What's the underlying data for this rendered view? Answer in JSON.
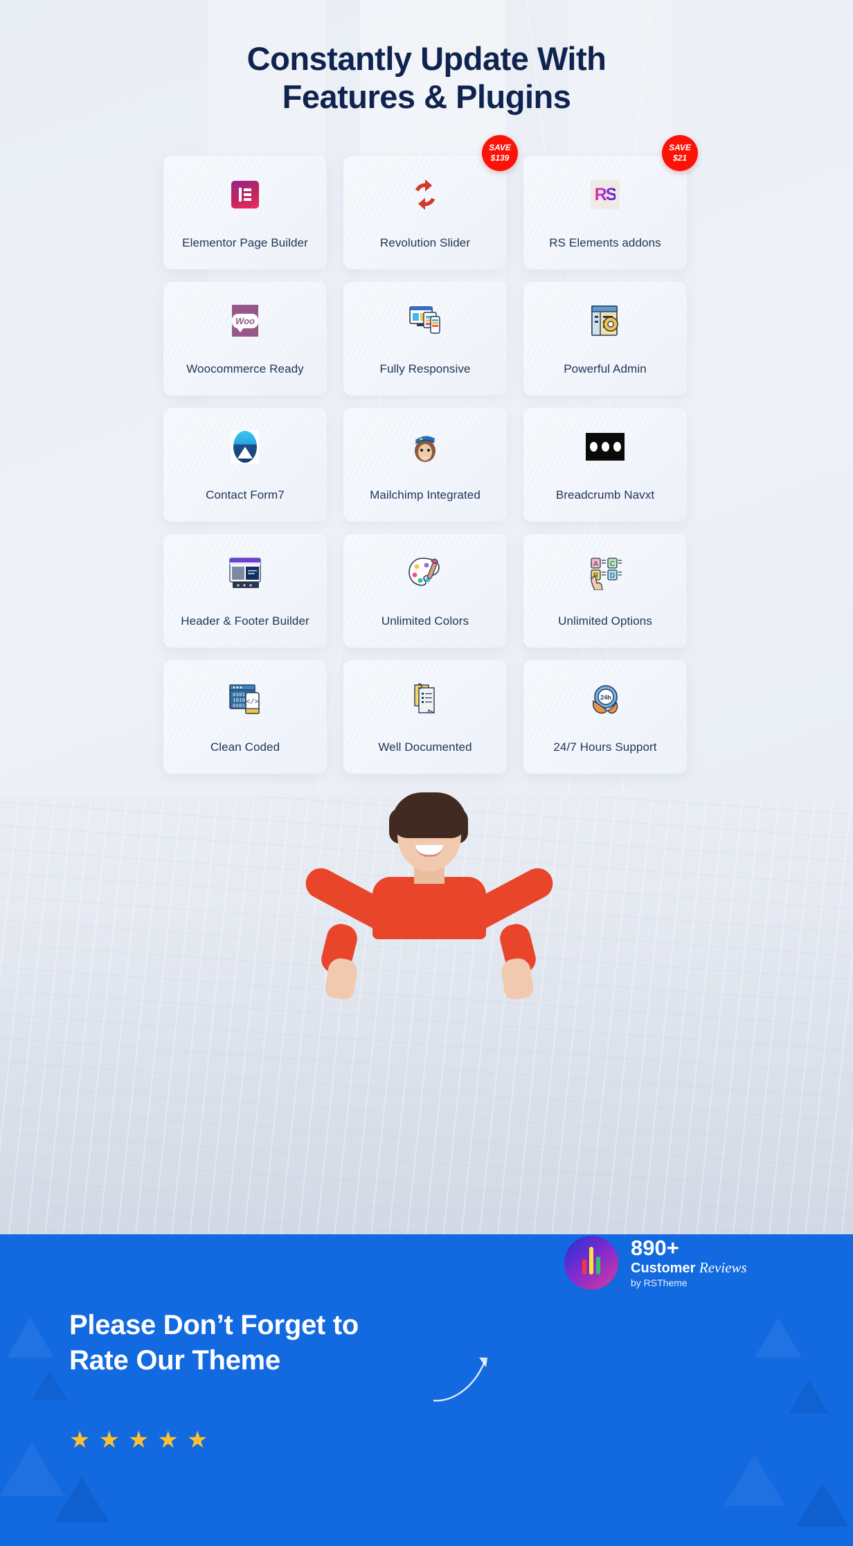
{
  "heading": {
    "accent_word": "Constantly",
    "rest_line1": " Update With",
    "line2": "Features & Plugins"
  },
  "features": [
    {
      "label": "Elementor Page Builder",
      "icon": "elementor-icon",
      "badge": null
    },
    {
      "label": "Revolution Slider",
      "icon": "revolution-slider-icon",
      "badge": {
        "word": "SAVE",
        "amount": "$139"
      }
    },
    {
      "label": "RS Elements addons",
      "icon": "rs-elements-icon",
      "badge": {
        "word": "SAVE",
        "amount": "$21"
      }
    },
    {
      "label": "Woocommerce Ready",
      "icon": "woocommerce-icon",
      "badge": null
    },
    {
      "label": "Fully Responsive",
      "icon": "responsive-devices-icon",
      "badge": null
    },
    {
      "label": "Powerful Admin",
      "icon": "admin-panel-gear-icon",
      "badge": null
    },
    {
      "label": "Contact Form7",
      "icon": "contact-form7-icon",
      "badge": null
    },
    {
      "label": "Mailchimp Integrated",
      "icon": "mailchimp-monkey-icon",
      "badge": null
    },
    {
      "label": "Breadcrumb Navxt",
      "icon": "breadcrumb-dots-icon",
      "badge": null
    },
    {
      "label": "Header & Footer Builder",
      "icon": "header-footer-builder-icon",
      "badge": null
    },
    {
      "label": "Unlimited Colors",
      "icon": "color-palette-icon",
      "badge": null
    },
    {
      "label": "Unlimited Options",
      "icon": "options-select-icon",
      "badge": null
    },
    {
      "label": "Clean Coded",
      "icon": "clean-code-icon",
      "badge": null
    },
    {
      "label": "Well Documented",
      "icon": "document-icon",
      "badge": null
    },
    {
      "label": "24/7 Hours Support",
      "icon": "support-24h-icon",
      "badge": null
    }
  ],
  "cta": {
    "title_line1": "Please Don’t Forget to",
    "title_line2": "Rate Our Theme",
    "star_glyph": "★",
    "star_count": 5,
    "reviews": {
      "count": "890+",
      "customer_word": "Customer",
      "reviews_word": "Reviews",
      "by_line": "by RSTheme"
    }
  },
  "colors": {
    "accent_blue": "#1a6ee8",
    "cta_blue": "#1269e0",
    "heading_navy": "#0f2350",
    "badge_red": "#fb1308",
    "star_gold": "#fdc02f",
    "card_bg": "#f5f8fd"
  }
}
